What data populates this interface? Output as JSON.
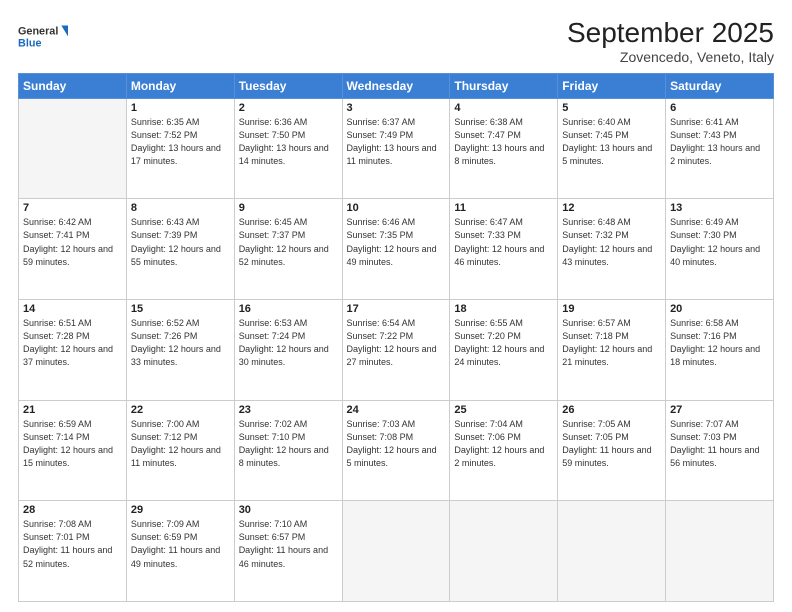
{
  "logo": {
    "line1": "General",
    "line2": "Blue"
  },
  "header": {
    "title": "September 2025",
    "location": "Zovencedo, Veneto, Italy"
  },
  "weekdays": [
    "Sunday",
    "Monday",
    "Tuesday",
    "Wednesday",
    "Thursday",
    "Friday",
    "Saturday"
  ],
  "weeks": [
    [
      {
        "day": null
      },
      {
        "day": 1,
        "sunrise": "6:35 AM",
        "sunset": "7:52 PM",
        "daylight": "13 hours and 17 minutes."
      },
      {
        "day": 2,
        "sunrise": "6:36 AM",
        "sunset": "7:50 PM",
        "daylight": "13 hours and 14 minutes."
      },
      {
        "day": 3,
        "sunrise": "6:37 AM",
        "sunset": "7:49 PM",
        "daylight": "13 hours and 11 minutes."
      },
      {
        "day": 4,
        "sunrise": "6:38 AM",
        "sunset": "7:47 PM",
        "daylight": "13 hours and 8 minutes."
      },
      {
        "day": 5,
        "sunrise": "6:40 AM",
        "sunset": "7:45 PM",
        "daylight": "13 hours and 5 minutes."
      },
      {
        "day": 6,
        "sunrise": "6:41 AM",
        "sunset": "7:43 PM",
        "daylight": "13 hours and 2 minutes."
      }
    ],
    [
      {
        "day": 7,
        "sunrise": "6:42 AM",
        "sunset": "7:41 PM",
        "daylight": "12 hours and 59 minutes."
      },
      {
        "day": 8,
        "sunrise": "6:43 AM",
        "sunset": "7:39 PM",
        "daylight": "12 hours and 55 minutes."
      },
      {
        "day": 9,
        "sunrise": "6:45 AM",
        "sunset": "7:37 PM",
        "daylight": "12 hours and 52 minutes."
      },
      {
        "day": 10,
        "sunrise": "6:46 AM",
        "sunset": "7:35 PM",
        "daylight": "12 hours and 49 minutes."
      },
      {
        "day": 11,
        "sunrise": "6:47 AM",
        "sunset": "7:33 PM",
        "daylight": "12 hours and 46 minutes."
      },
      {
        "day": 12,
        "sunrise": "6:48 AM",
        "sunset": "7:32 PM",
        "daylight": "12 hours and 43 minutes."
      },
      {
        "day": 13,
        "sunrise": "6:49 AM",
        "sunset": "7:30 PM",
        "daylight": "12 hours and 40 minutes."
      }
    ],
    [
      {
        "day": 14,
        "sunrise": "6:51 AM",
        "sunset": "7:28 PM",
        "daylight": "12 hours and 37 minutes."
      },
      {
        "day": 15,
        "sunrise": "6:52 AM",
        "sunset": "7:26 PM",
        "daylight": "12 hours and 33 minutes."
      },
      {
        "day": 16,
        "sunrise": "6:53 AM",
        "sunset": "7:24 PM",
        "daylight": "12 hours and 30 minutes."
      },
      {
        "day": 17,
        "sunrise": "6:54 AM",
        "sunset": "7:22 PM",
        "daylight": "12 hours and 27 minutes."
      },
      {
        "day": 18,
        "sunrise": "6:55 AM",
        "sunset": "7:20 PM",
        "daylight": "12 hours and 24 minutes."
      },
      {
        "day": 19,
        "sunrise": "6:57 AM",
        "sunset": "7:18 PM",
        "daylight": "12 hours and 21 minutes."
      },
      {
        "day": 20,
        "sunrise": "6:58 AM",
        "sunset": "7:16 PM",
        "daylight": "12 hours and 18 minutes."
      }
    ],
    [
      {
        "day": 21,
        "sunrise": "6:59 AM",
        "sunset": "7:14 PM",
        "daylight": "12 hours and 15 minutes."
      },
      {
        "day": 22,
        "sunrise": "7:00 AM",
        "sunset": "7:12 PM",
        "daylight": "12 hours and 11 minutes."
      },
      {
        "day": 23,
        "sunrise": "7:02 AM",
        "sunset": "7:10 PM",
        "daylight": "12 hours and 8 minutes."
      },
      {
        "day": 24,
        "sunrise": "7:03 AM",
        "sunset": "7:08 PM",
        "daylight": "12 hours and 5 minutes."
      },
      {
        "day": 25,
        "sunrise": "7:04 AM",
        "sunset": "7:06 PM",
        "daylight": "12 hours and 2 minutes."
      },
      {
        "day": 26,
        "sunrise": "7:05 AM",
        "sunset": "7:05 PM",
        "daylight": "11 hours and 59 minutes."
      },
      {
        "day": 27,
        "sunrise": "7:07 AM",
        "sunset": "7:03 PM",
        "daylight": "11 hours and 56 minutes."
      }
    ],
    [
      {
        "day": 28,
        "sunrise": "7:08 AM",
        "sunset": "7:01 PM",
        "daylight": "11 hours and 52 minutes."
      },
      {
        "day": 29,
        "sunrise": "7:09 AM",
        "sunset": "6:59 PM",
        "daylight": "11 hours and 49 minutes."
      },
      {
        "day": 30,
        "sunrise": "7:10 AM",
        "sunset": "6:57 PM",
        "daylight": "11 hours and 46 minutes."
      },
      {
        "day": null
      },
      {
        "day": null
      },
      {
        "day": null
      },
      {
        "day": null
      }
    ]
  ]
}
